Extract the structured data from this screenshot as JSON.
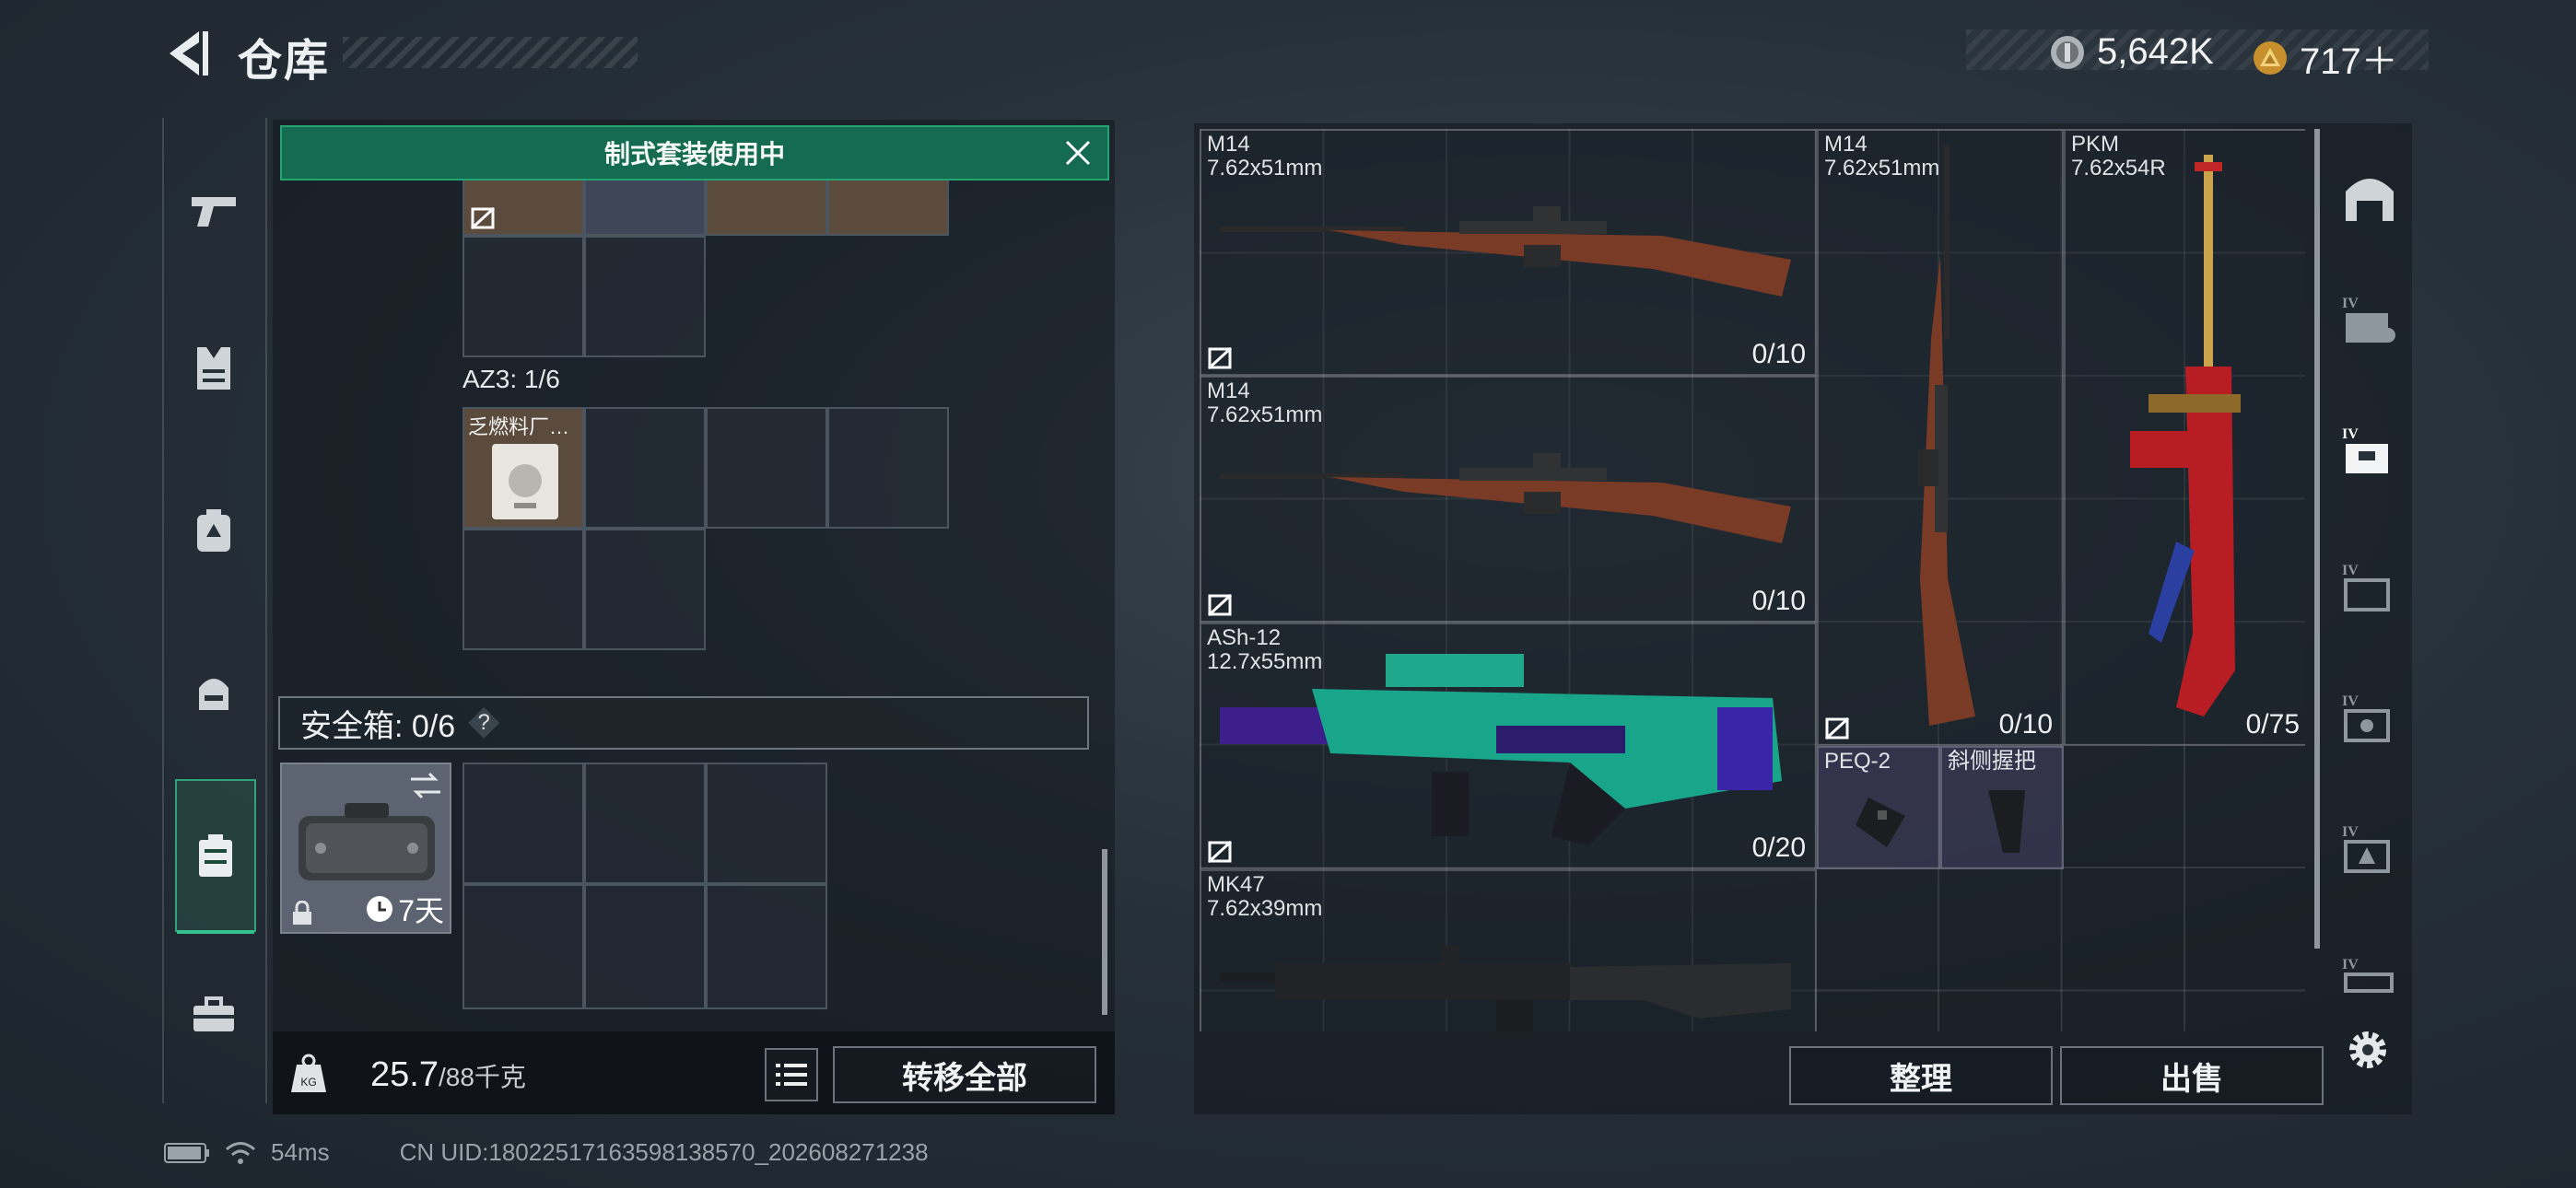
{
  "header": {
    "title": "仓库",
    "currency": [
      {
        "icon": "silver-coin-icon",
        "value": "5,642K",
        "color": "#c9cdd1"
      },
      {
        "icon": "gold-triangle-coin-icon",
        "value": "717＋",
        "color": "#d7a43a"
      }
    ]
  },
  "left_rail": [
    "pistol-icon",
    "vest-icon",
    "backpack-icon",
    "helmet-bag-icon",
    "container-icon",
    "toolbox-icon"
  ],
  "kit_banner": {
    "text": "制式套装使用中"
  },
  "az3": {
    "label": "AZ3: 1/6",
    "item_tag": "乏燃料厂…"
  },
  "safe_box": {
    "label": "安全箱: 0/6",
    "help": "?",
    "timer": "7天"
  },
  "weight": {
    "current": "25.7",
    "max": "/88千克"
  },
  "buttons": {
    "transfer_all": "转移全部",
    "organize": "整理",
    "sell": "出售"
  },
  "weapons": [
    {
      "name": "M14",
      "ammo_type": "7.62x51mm",
      "count": "0/10"
    },
    {
      "name": "M14",
      "ammo_type": "7.62x51mm",
      "count": "0/10"
    },
    {
      "name": "M14",
      "ammo_type": "7.62x51mm",
      "count": "0/10"
    },
    {
      "name": "PKM",
      "ammo_type": "7.62x54R",
      "count": "0/75"
    },
    {
      "name": "ASh-12",
      "ammo_type": "12.7x55mm",
      "count": "0/20"
    },
    {
      "name": "MK47",
      "ammo_type": "7.62x39mm",
      "count": ""
    }
  ],
  "attachments": [
    {
      "name": "PEQ-2"
    },
    {
      "name": "斜侧握把"
    }
  ],
  "right_rail": [
    {
      "icon": "vault-icon",
      "label": ""
    },
    {
      "icon": "storage-iv-1-icon",
      "label": "IV"
    },
    {
      "icon": "storage-iv-2-icon",
      "label": "IV"
    },
    {
      "icon": "storage-iv-3-icon",
      "label": "IV"
    },
    {
      "icon": "storage-iv-4-icon",
      "label": "IV"
    },
    {
      "icon": "storage-iv-5-icon",
      "label": "IV"
    },
    {
      "icon": "storage-iv-6-icon",
      "label": "IV"
    }
  ],
  "status": {
    "ping": "54ms",
    "uid": "CN UID:18022517163598138570_202608271238"
  }
}
